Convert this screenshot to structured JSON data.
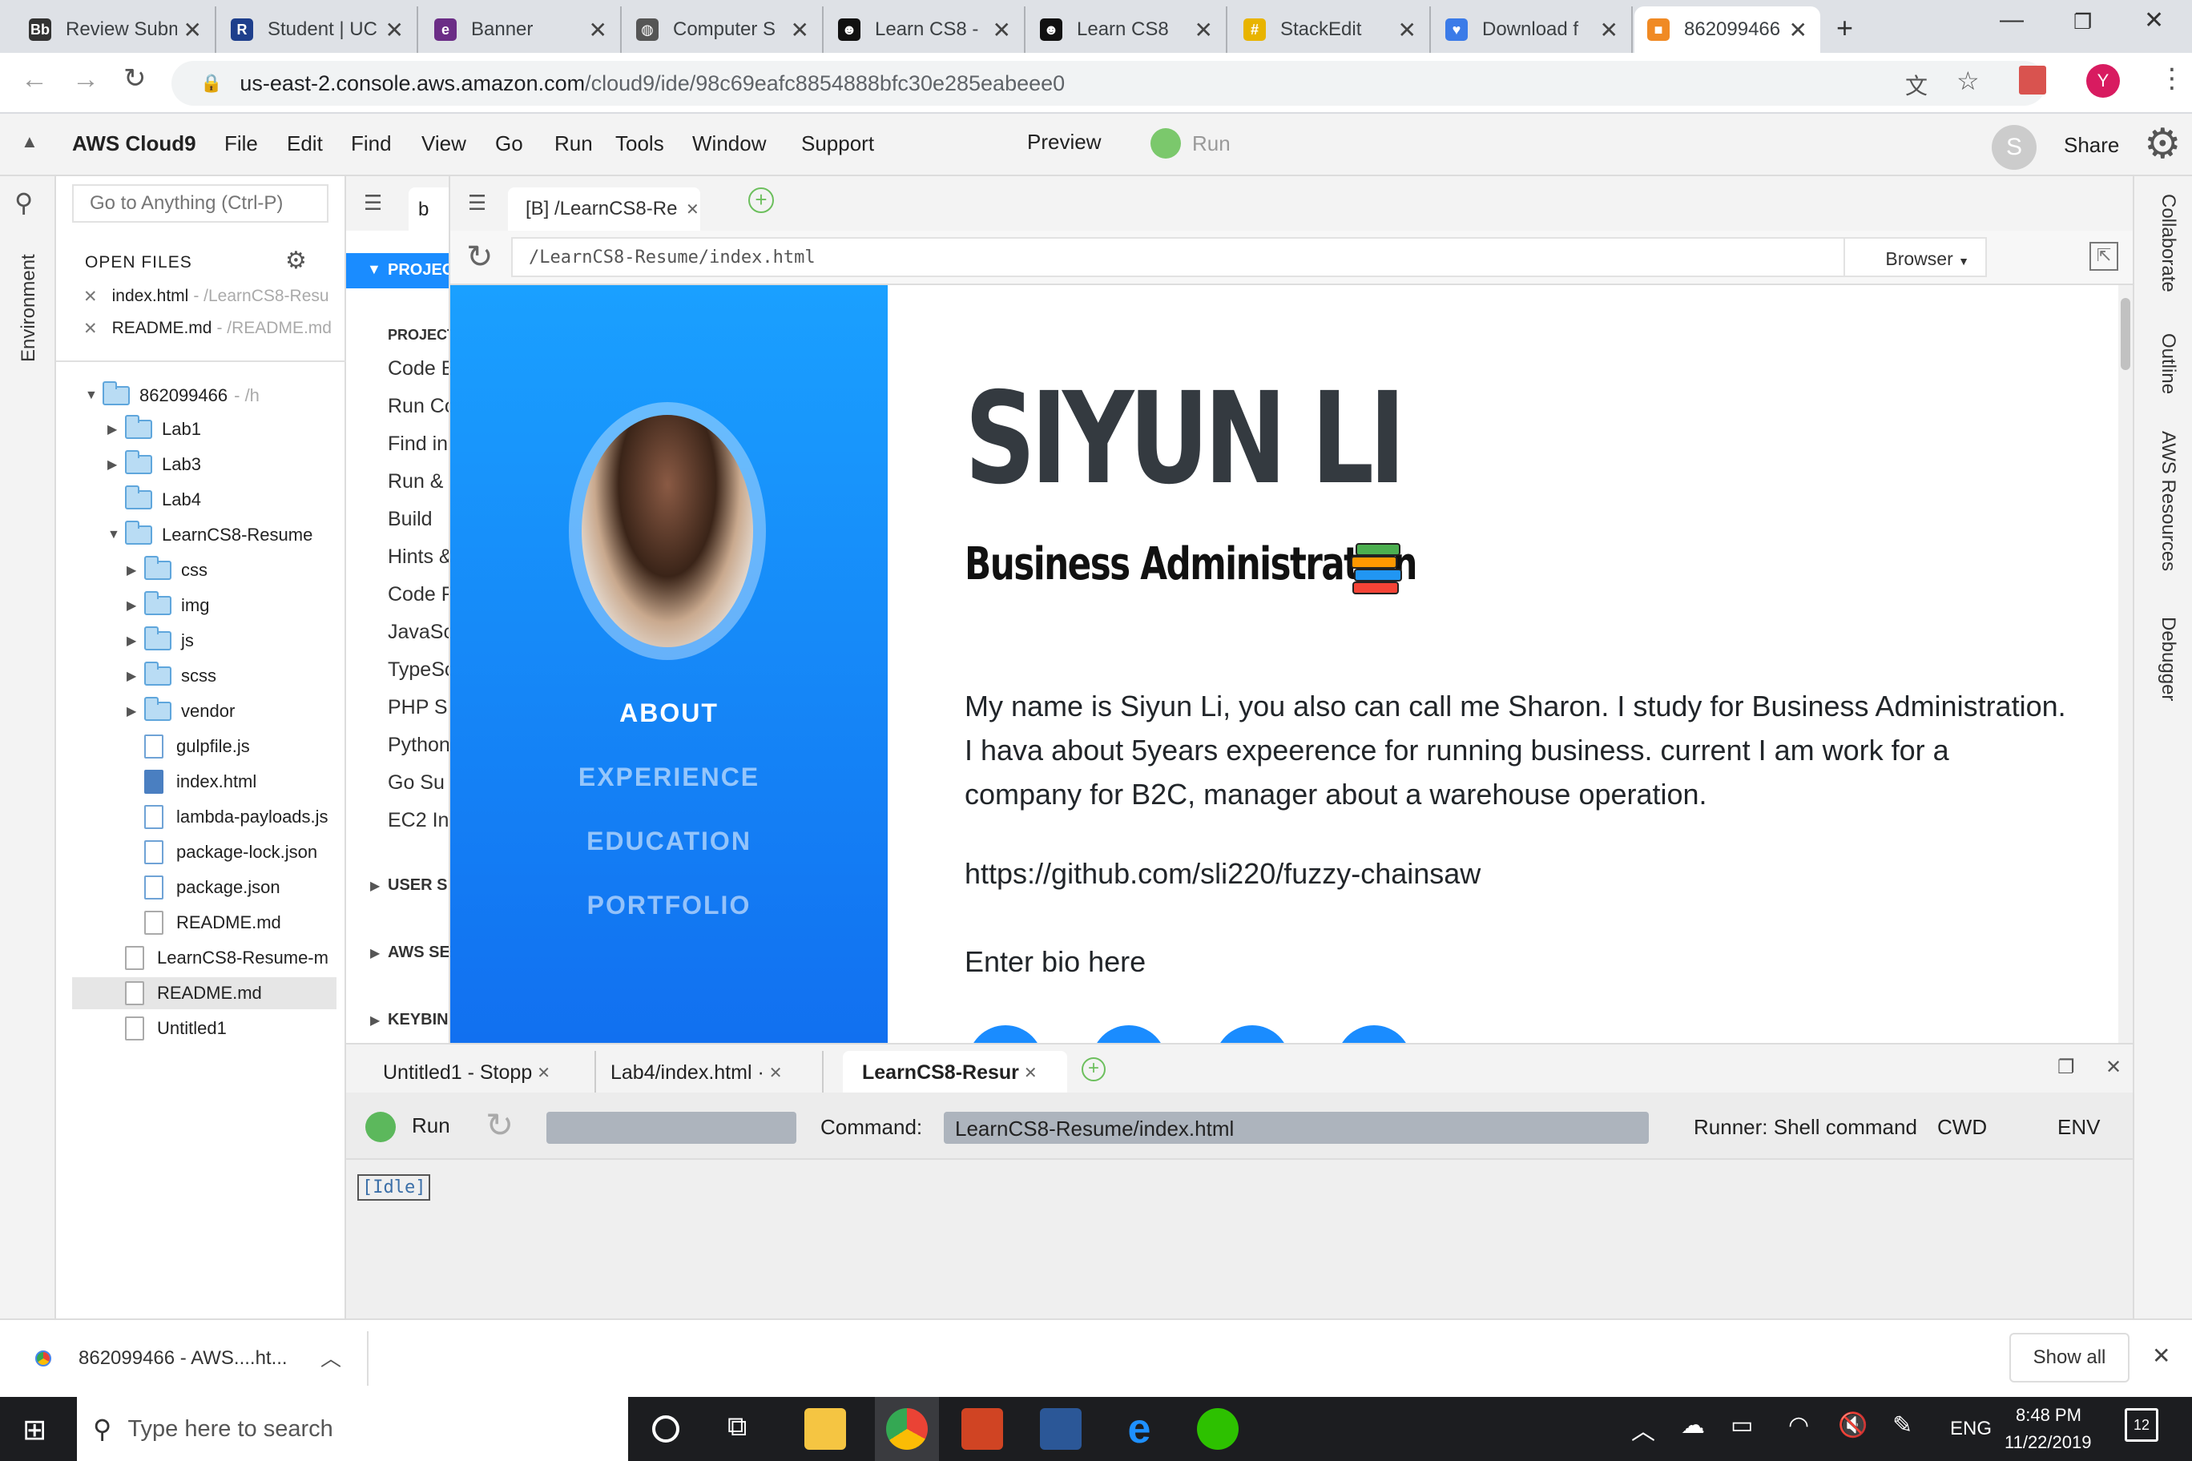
{
  "browser": {
    "tabs": [
      {
        "title": "Review Submissio",
        "icon": "blackboard-icon",
        "active": false
      },
      {
        "title": "Student | UC",
        "icon": "r-icon",
        "active": false
      },
      {
        "title": "Banner",
        "icon": "e-icon",
        "active": false
      },
      {
        "title": "Computer S",
        "icon": "globe-icon",
        "active": false
      },
      {
        "title": "Learn CS8 -",
        "icon": "smiley-icon",
        "active": false
      },
      {
        "title": "Learn CS8",
        "icon": "smiley-icon",
        "active": false
      },
      {
        "title": "StackEdit",
        "icon": "stackedit-icon",
        "active": false
      },
      {
        "title": "Download f",
        "icon": "heart-icon",
        "active": false
      },
      {
        "title": "862099466",
        "icon": "aws-cube-icon",
        "active": true
      }
    ],
    "url_host": "us-east-2.console.aws.amazon.com",
    "url_path": "/cloud9/ide/98c69eafc8854888bfc30e285eabeee0",
    "profile_initial": "Y"
  },
  "ide": {
    "brand": "AWS Cloud9",
    "menu": [
      "File",
      "Edit",
      "Find",
      "View",
      "Go",
      "Run",
      "Tools",
      "Window",
      "Support"
    ],
    "preview_label": "Preview",
    "run_label": "Run",
    "user_initial": "S",
    "share_label": "Share",
    "goto_placeholder": "Go to Anything (Ctrl-P)",
    "left_rail_label": "Environment",
    "right_rail": [
      "Collaborate",
      "Outline",
      "AWS Resources",
      "Debugger"
    ]
  },
  "tree": {
    "open_files_header": "OPEN FILES",
    "open_files": [
      {
        "name": "index.html",
        "path": "- /LearnCS8-Resu"
      },
      {
        "name": "README.md",
        "path": "- /README.md"
      }
    ],
    "root": {
      "name": "862099466",
      "path": "- /h"
    },
    "items": [
      {
        "name": "Lab1",
        "type": "folder",
        "depth": 1,
        "arrow": "▶"
      },
      {
        "name": "Lab3",
        "type": "folder",
        "depth": 1,
        "arrow": "▶"
      },
      {
        "name": "Lab4",
        "type": "folder",
        "depth": 1,
        "arrow": ""
      },
      {
        "name": "LearnCS8-Resume",
        "type": "folder",
        "depth": 1,
        "arrow": "▼"
      },
      {
        "name": "css",
        "type": "folder",
        "depth": 2,
        "arrow": "▶"
      },
      {
        "name": "img",
        "type": "folder",
        "depth": 2,
        "arrow": "▶"
      },
      {
        "name": "js",
        "type": "folder",
        "depth": 2,
        "arrow": "▶"
      },
      {
        "name": "scss",
        "type": "folder",
        "depth": 2,
        "arrow": "▶"
      },
      {
        "name": "vendor",
        "type": "folder",
        "depth": 2,
        "arrow": "▶"
      },
      {
        "name": "gulpfile.js",
        "type": "js",
        "depth": 2,
        "arrow": ""
      },
      {
        "name": "index.html",
        "type": "html",
        "depth": 2,
        "arrow": ""
      },
      {
        "name": "lambda-payloads.js",
        "type": "js",
        "depth": 2,
        "arrow": ""
      },
      {
        "name": "package-lock.json",
        "type": "js",
        "depth": 2,
        "arrow": ""
      },
      {
        "name": "package.json",
        "type": "js",
        "depth": 2,
        "arrow": ""
      },
      {
        "name": "README.md",
        "type": "file",
        "depth": 2,
        "arrow": ""
      },
      {
        "name": "LearnCS8-Resume-m",
        "type": "file",
        "depth": 1,
        "arrow": ""
      },
      {
        "name": "README.md",
        "type": "file",
        "depth": 1,
        "arrow": "",
        "selected": true
      },
      {
        "name": "Untitled1",
        "type": "file",
        "depth": 1,
        "arrow": ""
      }
    ]
  },
  "commands": {
    "tab_label": "b",
    "header": "PROJEC",
    "group": "PROJECT",
    "items": [
      "Code E",
      "Run Co",
      "Find in",
      "Run &",
      "Build",
      "Hints &",
      "Code F",
      "JavaSc",
      "TypeSc",
      "PHP S",
      "Python",
      "Go Su",
      "EC2 In"
    ],
    "sections": [
      "USER S",
      "AWS SE",
      "KEYBIN"
    ]
  },
  "editor": {
    "tab_title": "[B] /LearnCS8-Re",
    "preview_url": "/LearnCS8-Resume/index.html",
    "browser_select": "Browser"
  },
  "resume": {
    "name": "SIYUN LI",
    "subtitle": "Business Administration",
    "nav": [
      "ABOUT",
      "EXPERIENCE",
      "EDUCATION",
      "PORTFOLIO"
    ],
    "bio": "My name is Siyun Li, you also can call me Sharon. I study for Business Administration. I hava about 5years expeerence for running business. current I am work for a company for B2C, manager about a warehouse operation.",
    "link": "https://github.com/sli220/fuzzy-chainsaw",
    "bio2": "Enter bio here"
  },
  "console": {
    "tabs": [
      "Untitled1 - Stopp",
      "Lab4/index.html ·",
      "LearnCS8-Resur"
    ],
    "run_label": "Run",
    "command_label": "Command:",
    "command_value": "LearnCS8-Resume/index.html",
    "runner": "Runner: Shell command",
    "cwd": "CWD",
    "env": "ENV",
    "output": "[Idle]"
  },
  "download": {
    "file": "862099466 - AWS....ht...",
    "show_all": "Show all"
  },
  "taskbar": {
    "search_placeholder": "Type here to search",
    "lang": "ENG",
    "time": "8:48 PM",
    "date": "11/22/2019",
    "notifications": "12"
  }
}
